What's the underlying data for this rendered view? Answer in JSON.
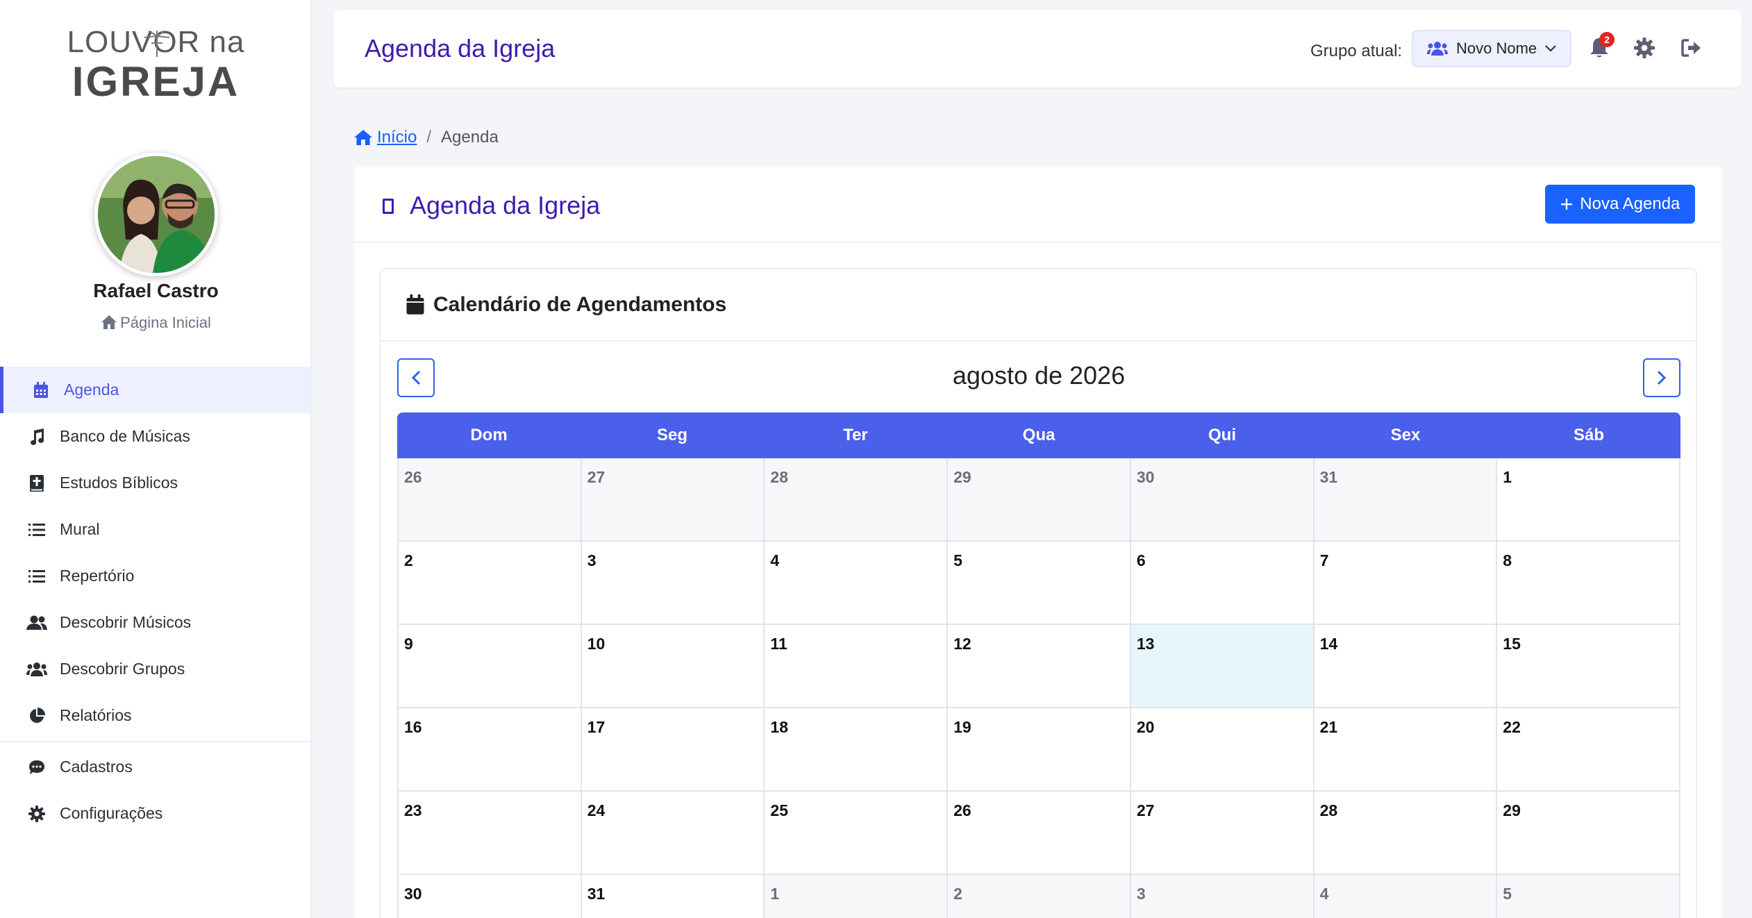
{
  "logo": {
    "line1": "LOUVOR na",
    "line2": "IGREJA"
  },
  "user": {
    "name": "Rafael Castro",
    "home_label": "Página Inicial"
  },
  "nav": [
    {
      "label": "Agenda",
      "icon": "calendar-icon",
      "active": true
    },
    {
      "label": "Banco de Músicas",
      "icon": "music-note-icon"
    },
    {
      "label": "Estudos Bíblicos",
      "icon": "bible-icon"
    },
    {
      "label": "Mural",
      "icon": "list-icon"
    },
    {
      "label": "Repertório",
      "icon": "list-icon"
    },
    {
      "label": "Descobrir Músicos",
      "icon": "users-icon"
    },
    {
      "label": "Descobrir Grupos",
      "icon": "users-group-icon"
    },
    {
      "label": "Relatórios",
      "icon": "pie-chart-icon"
    },
    {
      "label": "Cadastros",
      "icon": "chat-icon"
    },
    {
      "label": "Configurações",
      "icon": "gear-icon"
    }
  ],
  "header": {
    "title": "Agenda da Igreja",
    "group_label": "Grupo atual:",
    "group_value": "Novo Nome",
    "notification_count": "2"
  },
  "breadcrumb": {
    "home": "Início",
    "sep": "/",
    "current": "Agenda"
  },
  "page": {
    "title": "Agenda da Igreja",
    "new_button": "Nova Agenda"
  },
  "calendar": {
    "card_title": "Calendário de Agendamentos",
    "month": "agosto de 2026",
    "weekdays": [
      "Dom",
      "Seg",
      "Ter",
      "Qua",
      "Qui",
      "Sex",
      "Sáb"
    ],
    "days": [
      {
        "n": "26",
        "other": true
      },
      {
        "n": "27",
        "other": true
      },
      {
        "n": "28",
        "other": true
      },
      {
        "n": "29",
        "other": true
      },
      {
        "n": "30",
        "other": true
      },
      {
        "n": "31",
        "other": true
      },
      {
        "n": "1"
      },
      {
        "n": "2"
      },
      {
        "n": "3"
      },
      {
        "n": "4"
      },
      {
        "n": "5"
      },
      {
        "n": "6"
      },
      {
        "n": "7"
      },
      {
        "n": "8"
      },
      {
        "n": "9"
      },
      {
        "n": "10"
      },
      {
        "n": "11"
      },
      {
        "n": "12"
      },
      {
        "n": "13",
        "today": true
      },
      {
        "n": "14"
      },
      {
        "n": "15"
      },
      {
        "n": "16"
      },
      {
        "n": "17"
      },
      {
        "n": "18"
      },
      {
        "n": "19"
      },
      {
        "n": "20"
      },
      {
        "n": "21"
      },
      {
        "n": "22"
      },
      {
        "n": "23"
      },
      {
        "n": "24"
      },
      {
        "n": "25"
      },
      {
        "n": "26"
      },
      {
        "n": "27"
      },
      {
        "n": "28"
      },
      {
        "n": "29"
      },
      {
        "n": "30"
      },
      {
        "n": "31"
      },
      {
        "n": "1",
        "other": true
      },
      {
        "n": "2",
        "other": true
      },
      {
        "n": "3",
        "other": true
      },
      {
        "n": "4",
        "other": true
      },
      {
        "n": "5",
        "other": true
      }
    ]
  },
  "colors": {
    "accent": "#4a5fea",
    "title": "#3f1bb0",
    "primary_button": "#1a62ff",
    "today": "#e7f6fd"
  }
}
